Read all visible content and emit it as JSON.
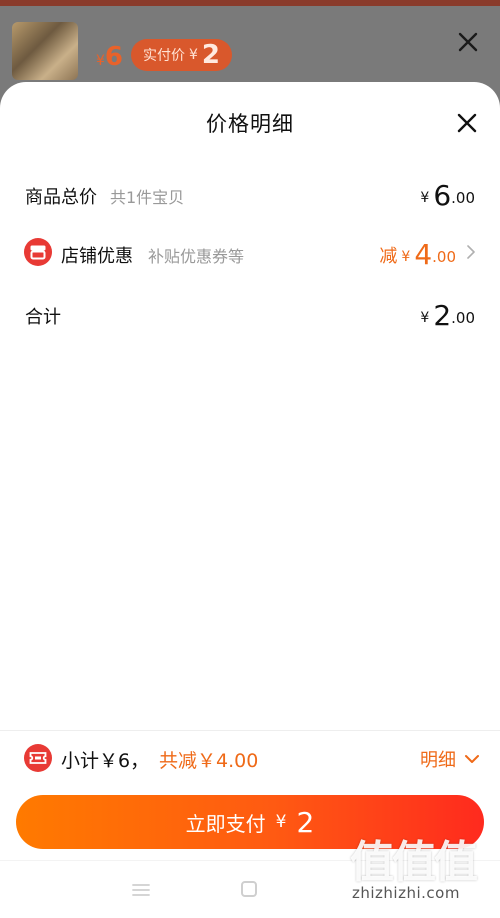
{
  "background": {
    "price_currency": "¥",
    "price_value": "6",
    "badge_label": "实付价",
    "badge_currency": "¥",
    "badge_value": "2"
  },
  "sheet": {
    "title": "价格明细",
    "rows": [
      {
        "label": "商品总价",
        "sub": "共1件宝贝",
        "prefix": "",
        "currency": "¥",
        "integer": "6",
        "decimal": ".00"
      },
      {
        "label": "店铺优惠",
        "sub": "补贴优惠券等",
        "prefix": "减",
        "currency": "¥",
        "integer": "4",
        "decimal": ".00"
      },
      {
        "label": "合计",
        "sub": "",
        "prefix": "",
        "currency": "¥",
        "integer": "2",
        "decimal": ".00"
      }
    ]
  },
  "footer": {
    "subtotal_text": "小计￥6，",
    "discount_text": "共减￥4.00",
    "detail_link": "明细",
    "pay_label": "立即支付",
    "pay_currency": "¥",
    "pay_amount": "2"
  },
  "watermark": {
    "chars": "值值值",
    "url": "zhizhizhi.com"
  },
  "colors": {
    "accent": "#ef6a18",
    "shop_icon": "#e83a35",
    "button_start": "#ff7a00",
    "button_end": "#ff2a1e"
  }
}
